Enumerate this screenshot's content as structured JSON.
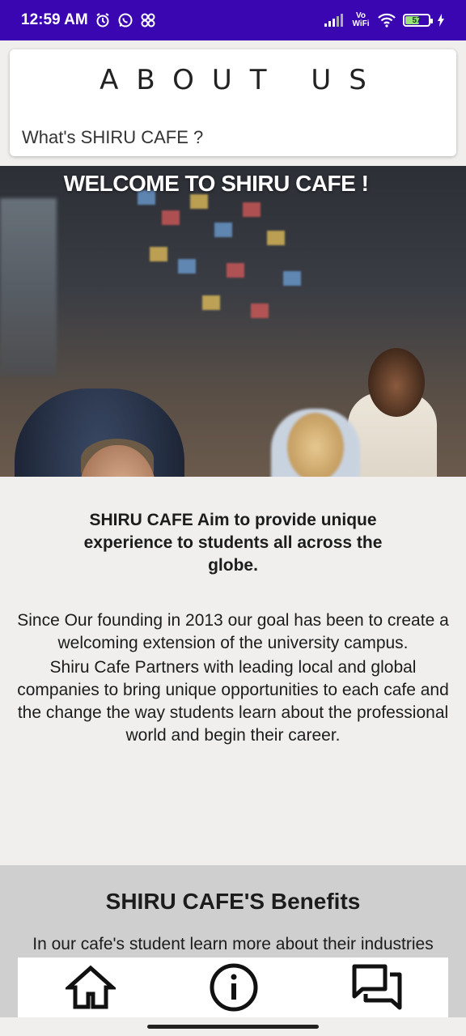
{
  "status_bar": {
    "time": "12:59 AM",
    "network_label": "Vo WiFi",
    "battery_level": "57"
  },
  "header": {
    "title": "ABOUT US",
    "subtitle": "What's SHIRU CAFE ?"
  },
  "hero": {
    "title": "WELCOME TO SHIRU CAFE !"
  },
  "about": {
    "aim": "SHIRU CAFE Aim to provide unique experience to students all across the globe.",
    "paragraph_1": "Since Our founding in 2013 our goal has been to create a welcoming extension of the university campus.",
    "paragraph_2": "Shiru Cafe Partners with leading local and global companies to bring unique opportunities to each cafe and the change the way students learn about the professional world and begin their career."
  },
  "benefits": {
    "title": "SHIRU CAFE'S Benefits",
    "text": "In our cafe's student learn more about their industries"
  },
  "bottom_nav": {
    "items": [
      {
        "icon": "home-icon"
      },
      {
        "icon": "info-icon"
      },
      {
        "icon": "forum-icon"
      }
    ]
  },
  "colors": {
    "status_bar": "#3a06b2",
    "page_background": "#f0efee",
    "benefits_background": "#cfcfcf"
  }
}
